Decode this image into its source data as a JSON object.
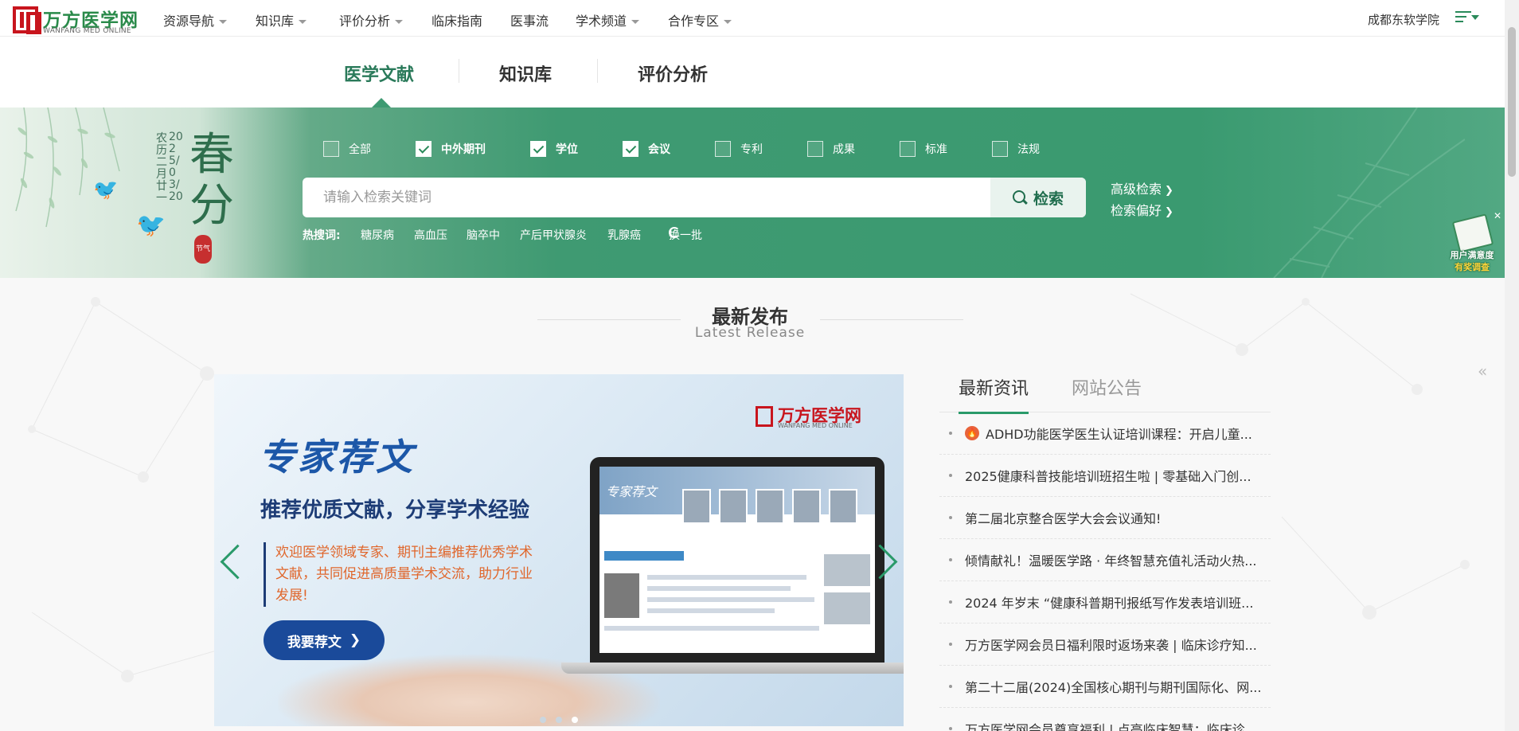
{
  "brand": {
    "name": "万方医学网",
    "sub": "WANFANG MED ONLINE"
  },
  "nav": {
    "items": [
      {
        "label": "资源导航",
        "dropdown": true
      },
      {
        "label": "知识库",
        "dropdown": true
      },
      {
        "label": "评价分析",
        "dropdown": true
      },
      {
        "label": "临床指南",
        "dropdown": false
      },
      {
        "label": "医事流",
        "dropdown": false
      },
      {
        "label": "学术频道",
        "dropdown": true
      },
      {
        "label": "合作专区",
        "dropdown": true
      }
    ],
    "org": "成都东软学院"
  },
  "subtabs": [
    "医学文献",
    "知识库",
    "评价分析"
  ],
  "banner": {
    "season": "春分",
    "date": "2025/03/20",
    "lunar": "农历二月廿一",
    "seal": "节气",
    "checkboxes": [
      {
        "label": "全部",
        "checked": false
      },
      {
        "label": "中外期刊",
        "checked": true
      },
      {
        "label": "学位",
        "checked": true
      },
      {
        "label": "会议",
        "checked": true
      },
      {
        "label": "专利",
        "checked": false
      },
      {
        "label": "成果",
        "checked": false
      },
      {
        "label": "标准",
        "checked": false
      },
      {
        "label": "法规",
        "checked": false
      }
    ],
    "search": {
      "placeholder": "请输入检索关键词",
      "value": "",
      "button": "检索"
    },
    "links": [
      "高级检索",
      "检索偏好"
    ],
    "hot_label": "热搜词:",
    "hot_words": [
      "糖尿病",
      "高血压",
      "脑卒中",
      "产后甲状腺炎",
      "乳腺癌"
    ],
    "refresh": "换一批",
    "survey": {
      "line1": "用户满意度",
      "line2": "有奖调查"
    }
  },
  "section": {
    "title": "最新发布",
    "subtitle": "Latest Release"
  },
  "carousel": {
    "logo_name": "万方医学网",
    "logo_sub": "WANFANG MED ONLINE",
    "title": "专家荐文",
    "subtitle": "推荐优质文献，分享学术经验",
    "description": "欢迎医学领域专家、期刊主编推荐优秀学术文献，共同促进高质量学术交流，助力行业发展!",
    "button": "我要荐文",
    "screen_title": "专家荐文"
  },
  "news": {
    "tabs": [
      "最新资讯",
      "网站公告"
    ],
    "items": [
      {
        "text": "ADHD功能医学医生认证培训课程：开启儿童...",
        "hot": true
      },
      {
        "text": "2025健康科普技能培训班招生啦 | 零基础入门创...",
        "hot": false
      },
      {
        "text": "第二届北京整合医学大会会议通知!",
        "hot": false
      },
      {
        "text": "倾情献礼！温暖医学路 · 年终智慧充值礼活动火热...",
        "hot": false
      },
      {
        "text": "2024 年岁末 “健康科普期刊报纸写作发表培训班...",
        "hot": false
      },
      {
        "text": "万方医学网会员日福利限时返场来袭 | 临床诊疗知...",
        "hot": false
      },
      {
        "text": "第二十二届(2024)全国核心期刊与期刊国际化、网...",
        "hot": false
      },
      {
        "text": "万方医学网会员尊享福利 | 点亮临床智慧：临床诊...",
        "hot": false
      }
    ]
  },
  "colors": {
    "brand_green": "#2a8a5a",
    "brand_red": "#c8151d",
    "banner_green": "#3f9a72"
  }
}
